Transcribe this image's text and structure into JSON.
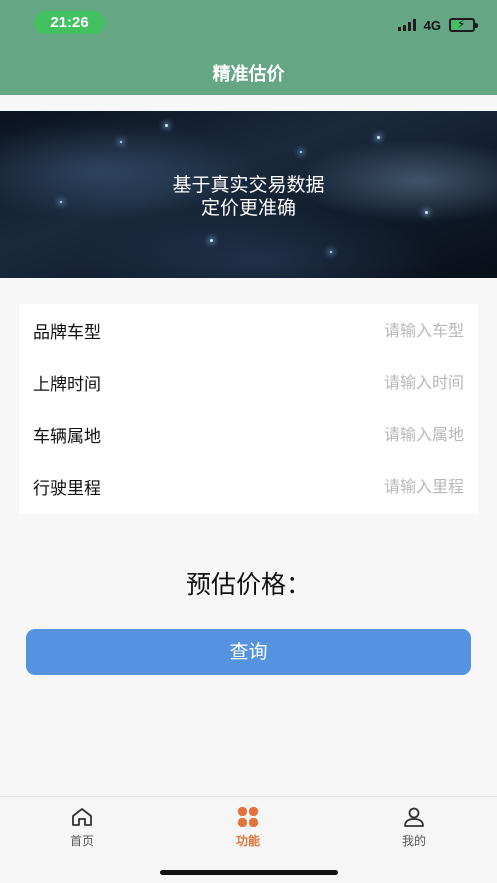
{
  "status_bar": {
    "time": "21:26",
    "network": "4G"
  },
  "header": {
    "title": "精准估价"
  },
  "banner": {
    "line1": "基于真实交易数据",
    "line2": "定价更准确"
  },
  "form": {
    "rows": [
      {
        "label": "品牌车型",
        "placeholder": "请输入车型"
      },
      {
        "label": "上牌时间",
        "placeholder": "请输入时间"
      },
      {
        "label": "车辆属地",
        "placeholder": "请输入属地"
      },
      {
        "label": "行驶里程",
        "placeholder": "请输入里程"
      }
    ]
  },
  "estimate_label": "预估价格：",
  "query_button": "查询",
  "tabbar": {
    "tabs": [
      {
        "label": "首页",
        "icon": "home-icon",
        "active": false
      },
      {
        "label": "功能",
        "icon": "grid-icon",
        "active": true
      },
      {
        "label": "我的",
        "icon": "user-icon",
        "active": false
      }
    ]
  },
  "colors": {
    "header": "#65a784",
    "accent": "#5592e0",
    "active_tab": "#e3733a",
    "time_pill": "#43c160"
  }
}
